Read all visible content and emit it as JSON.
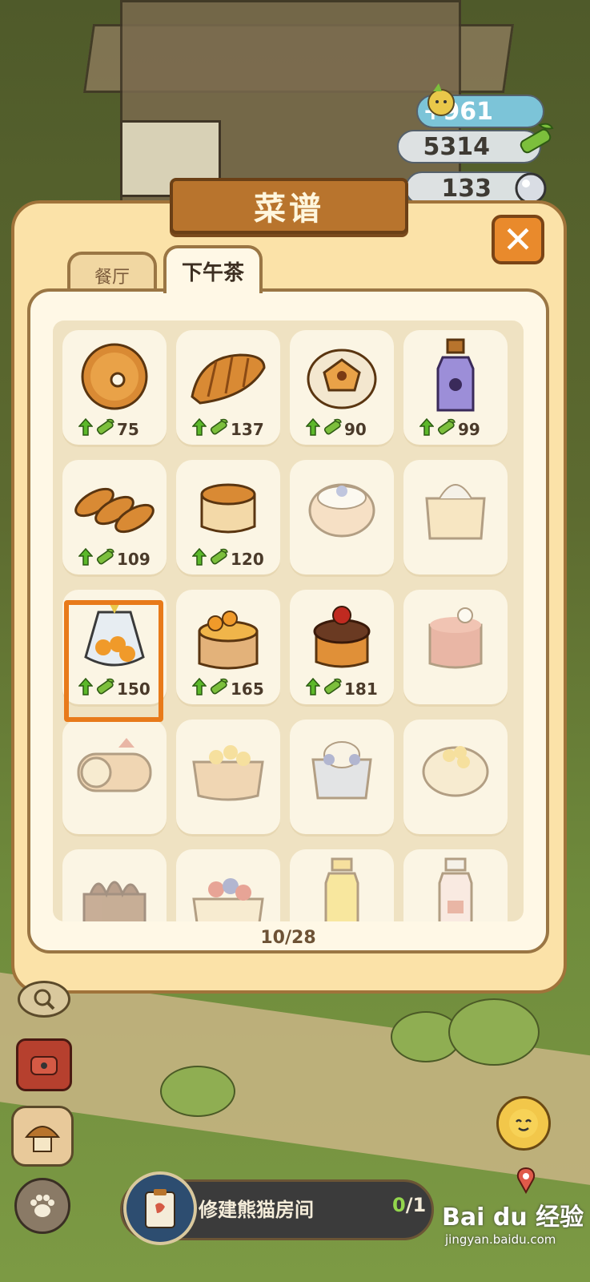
{
  "hud": {
    "bonus": "+961",
    "bamboo": "5314",
    "pearls": "133"
  },
  "dialog": {
    "title": "菜谱",
    "tabs": [
      {
        "label": "餐厅",
        "active": false
      },
      {
        "label": "下午茶",
        "active": true
      }
    ],
    "page_counter": "10/28"
  },
  "recipes": [
    {
      "name": "donut-icon",
      "price": "75",
      "unlocked": true
    },
    {
      "name": "croissant-icon",
      "price": "137",
      "unlocked": true
    },
    {
      "name": "egg-tart-icon",
      "price": "90",
      "unlocked": true
    },
    {
      "name": "berry-drink-bottle-icon",
      "price": "99",
      "unlocked": true
    },
    {
      "name": "mini-baguettes-icon",
      "price": "109",
      "unlocked": true
    },
    {
      "name": "pudding-cake-icon",
      "price": "120",
      "unlocked": true
    },
    {
      "name": "blueberry-bun-icon",
      "price": "",
      "unlocked": false
    },
    {
      "name": "bread-loaf-bag-icon",
      "price": "",
      "unlocked": false
    },
    {
      "name": "candy-bag-icon",
      "price": "150",
      "unlocked": true
    },
    {
      "name": "orange-cake-icon",
      "price": "165",
      "unlocked": true
    },
    {
      "name": "chocolate-cherry-cake-icon",
      "price": "181",
      "unlocked": true
    },
    {
      "name": "strawberry-mousse-icon",
      "price": "",
      "unlocked": false
    },
    {
      "name": "swiss-roll-icon",
      "price": "",
      "unlocked": false
    },
    {
      "name": "fruit-tart-icon",
      "price": "",
      "unlocked": false
    },
    {
      "name": "blueberry-parfait-icon",
      "price": "",
      "unlocked": false
    },
    {
      "name": "cream-puff-icon",
      "price": "",
      "unlocked": false
    },
    {
      "name": "chocolate-cake-icon",
      "price": "",
      "unlocked": false
    },
    {
      "name": "berry-tart-icon",
      "price": "",
      "unlocked": false
    },
    {
      "name": "juice-bottle-icon",
      "price": "",
      "unlocked": false
    },
    {
      "name": "strawberry-milk-icon",
      "price": "",
      "unlocked": false
    }
  ],
  "task": {
    "label": "修建熊猫房间",
    "done": "0",
    "total": "/1"
  },
  "watermark": {
    "brand": "Bai du 经验",
    "url": "jingyan.baidu.com"
  },
  "colors": {
    "accent": "#e87a1a",
    "panel": "#fff8e6",
    "frame": "#fbe2a8",
    "title_board": "#b8742d"
  }
}
